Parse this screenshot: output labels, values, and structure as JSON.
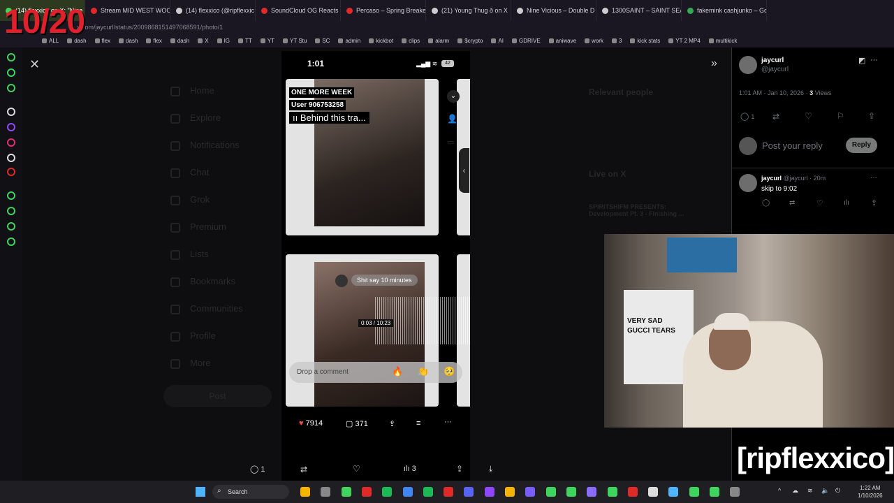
{
  "overlay": {
    "counter": "10/20",
    "watermark": "[ripflexxico]"
  },
  "browser": {
    "tabs": [
      {
        "label": "(14) flexxico on X: \"Nine V",
        "active": true,
        "color": "#3fd45d"
      },
      {
        "label": "Stream MID WEST WOO",
        "active": false,
        "color": "#e02a2a"
      },
      {
        "label": "(14) flexxico (@ripflexxic",
        "active": false,
        "color": "#cccccc"
      },
      {
        "label": "SoundCloud OG Reacts",
        "active": false,
        "color": "#e02a2a"
      },
      {
        "label": "Percaso – Spring Breake",
        "active": false,
        "color": "#e02a2a"
      },
      {
        "label": "(21) Young Thug ð on X",
        "active": false,
        "color": "#cccccc"
      },
      {
        "label": "Nine Vicious – Double D",
        "active": false,
        "color": "#cccccc"
      },
      {
        "label": "1300SAINT – SAINT SEA",
        "active": false,
        "color": "#cccccc"
      },
      {
        "label": "fakemink cashjunko – Go",
        "active": false,
        "color": "#34a853"
      }
    ],
    "url": "x.com/jaycurl/status/2009868151497068591/photo/1",
    "bookmarks": [
      "ALL",
      "dash",
      "flex",
      "dash",
      "flex",
      "dash",
      "X",
      "IG",
      "TT",
      "YT",
      "YT Stu",
      "SC",
      "admin",
      "kickbot",
      "clips",
      "alarm",
      "$crypto",
      "AI",
      "GDRIVE",
      "aniwave",
      "work",
      "3",
      "kick stats",
      "YT 2 MP4",
      "multikick"
    ]
  },
  "twitter_nav": [
    "Home",
    "Explore",
    "Notifications",
    "Chat",
    "Grok",
    "Premium",
    "Lists",
    "Bookmarks",
    "Communities",
    "Profile",
    "More"
  ],
  "twitter_post_button": "Post",
  "twitter_bg_right": {
    "relevant": "Relevant people",
    "live": "Live on X",
    "live_title": "SPIRITSHIFM PRESENTS: Development Pt. 3 - Finishing ..."
  },
  "phone": {
    "time": "1:01",
    "battery": "42",
    "card1_labels": [
      "ONE MORE WEEK",
      "User 906753258",
      "Behind this tra..."
    ],
    "bubble": "Shit say 10 minutes",
    "timestamp": "0:03 / 10:23",
    "comment_placeholder": "Drop a comment",
    "emojis": [
      "🔥",
      "👏",
      "🥺"
    ],
    "likes": "7914",
    "comments": "371"
  },
  "xbar": {
    "replies": "1",
    "views": "3"
  },
  "post": {
    "author_name": "jaycurl",
    "author_handle": "@jaycurl",
    "time": "1:01 AM · Jan 10, 2026 · ",
    "views": "3",
    "views_label": " Views",
    "reply_count": "1",
    "reply_placeholder": "Post your reply",
    "reply_button": "Reply"
  },
  "reply": {
    "name": "jaycurl",
    "handle_time": " @jaycurl · 20m",
    "text": "skip to 9:02"
  },
  "webcam": {
    "shirt_line1": "VERY SAD",
    "shirt_line2": "GUCCI TEARS"
  },
  "taskbar": {
    "search": "Search",
    "time": "1:22 AM",
    "date": "1/10/2026"
  }
}
